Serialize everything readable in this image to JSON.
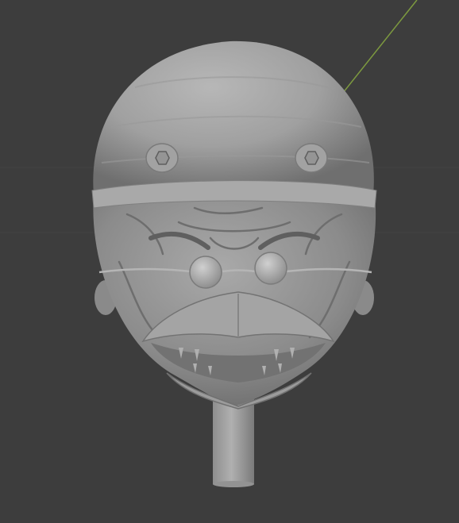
{
  "viewport": {
    "background": "#3d3d3d",
    "grid_line_color": "#434343",
    "y_axis_color": "#7d9a3f"
  },
  "model": {
    "surface_color": "#8f8f8f",
    "light_color": "#b4b4b4",
    "shadow_color": "#5f5f5f",
    "icon": "sculpted-head-mesh"
  }
}
